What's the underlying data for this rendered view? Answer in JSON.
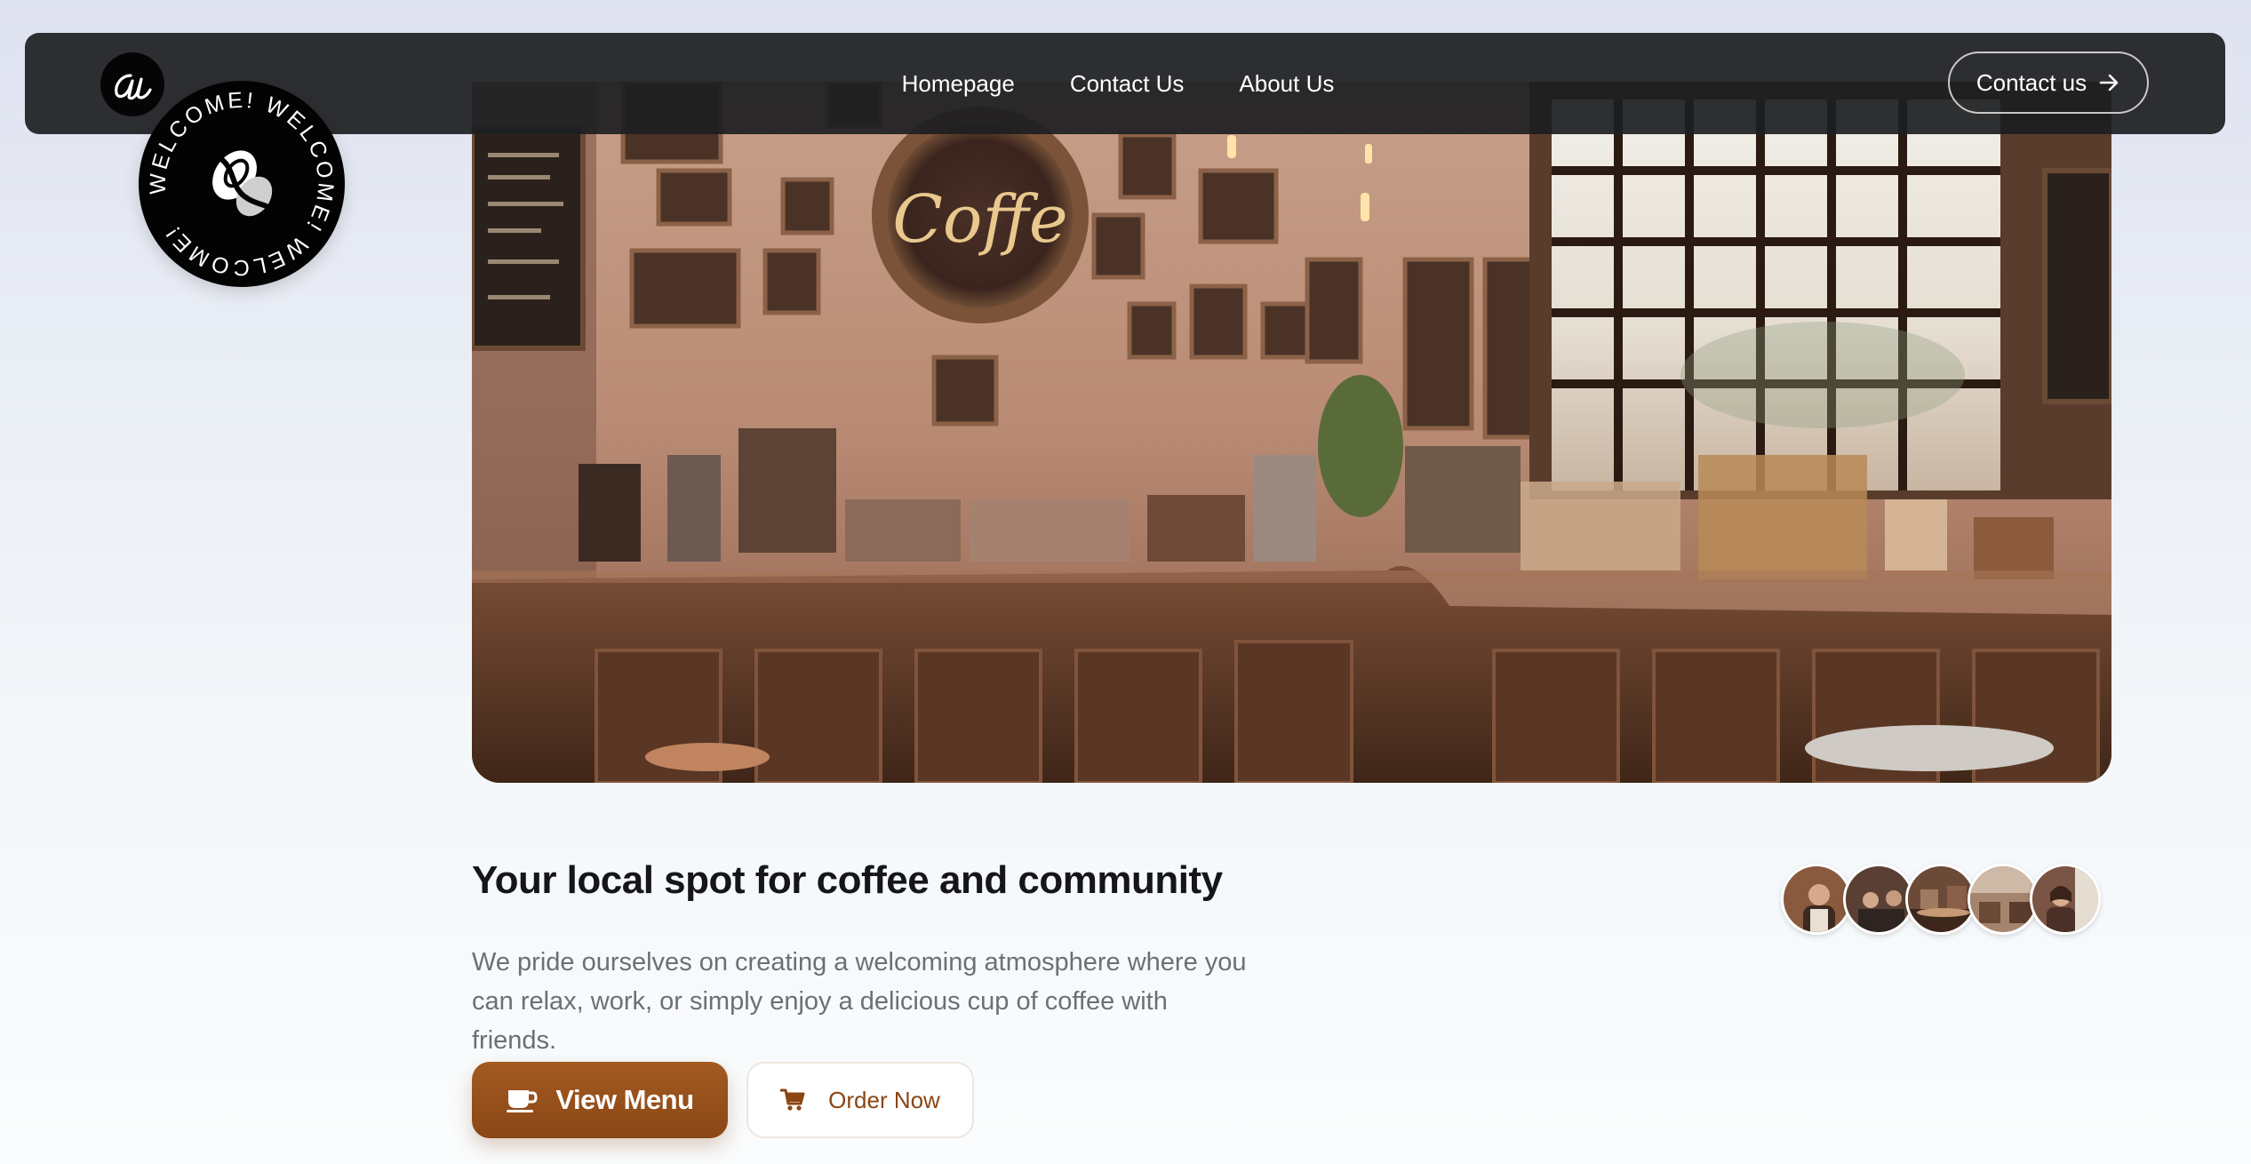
{
  "nav": {
    "logo_icon": "script-a-logo-icon",
    "links": [
      "Homepage",
      "Contact Us",
      "About Us"
    ],
    "cta_label": "Contact us",
    "cta_icon": "arrow-right-icon"
  },
  "badge": {
    "ring_text": "WELCOME! WELCOME! WELCOME! ",
    "icon": "coffee-bean-logo-icon"
  },
  "hero": {
    "image": "coffee-shop-interior-photo",
    "sign_text": "Coffe"
  },
  "content": {
    "headline": "Your local spot for coffee and community",
    "description": "We pride ourselves on creating a welcoming atmosphere where you can relax, work, or simply enjoy a delicious cup of coffee with friends."
  },
  "avatars": [
    "barista-photo",
    "customers-photo",
    "coffee-counter-photo",
    "cafe-seating-photo",
    "cafe-guest-photo"
  ],
  "buttons": {
    "primary_label": "View Menu",
    "primary_icon": "coffee-cup-icon",
    "secondary_label": "Order Now",
    "secondary_icon": "cart-icon"
  },
  "colors": {
    "nav_bg": "#1c1e21",
    "accent_brown": "#8b4513",
    "headline": "#16161a",
    "body_text": "#6c6f76"
  }
}
